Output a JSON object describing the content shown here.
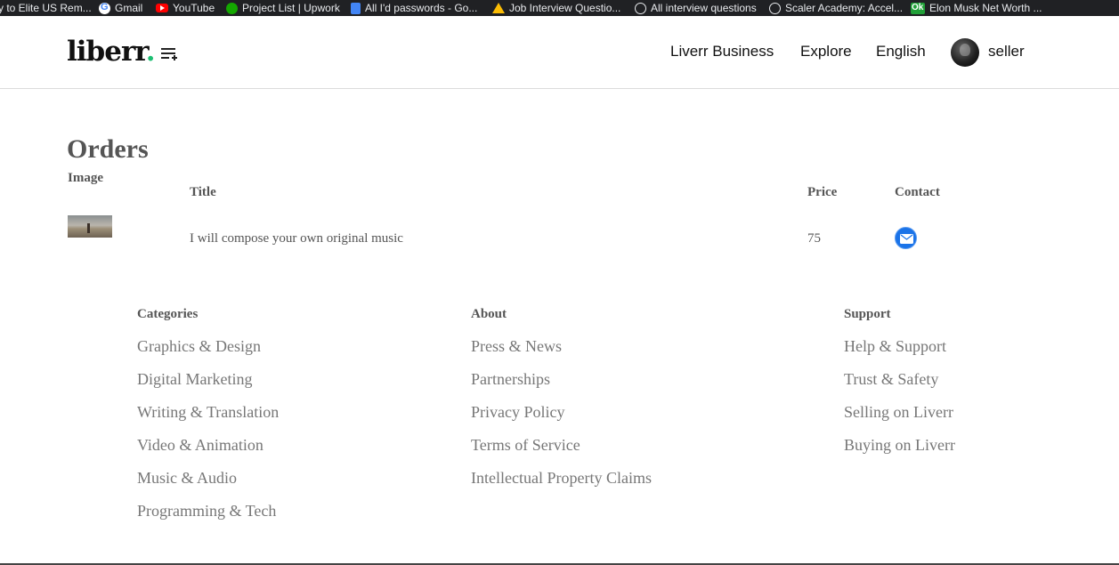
{
  "bookmarks": [
    "y to Elite US Rem...",
    "Gmail",
    "YouTube",
    "Project List | Upwork",
    "All I'd passwords - Go...",
    "Job Interview Questio...",
    "All interview questions",
    "Scaler Academy: Accel...",
    "Elon Musk Net Worth ..."
  ],
  "navbar": {
    "logo_text": "liberr",
    "logo_dot": ".",
    "business": "Liverr Business",
    "explore": "Explore",
    "language": "English",
    "username": "seller"
  },
  "orders": {
    "title": "Orders",
    "headers": {
      "image": "Image",
      "title": "Title",
      "price": "Price",
      "contact": "Contact"
    },
    "rows": [
      {
        "title": "I will compose your own original music",
        "price": "75"
      }
    ]
  },
  "footer": {
    "categories": {
      "heading": "Categories",
      "links": [
        "Graphics & Design",
        "Digital Marketing",
        "Writing & Translation",
        "Video & Animation",
        "Music & Audio",
        "Programming & Tech"
      ]
    },
    "about": {
      "heading": "About",
      "links": [
        "Press & News",
        "Partnerships",
        "Privacy Policy",
        "Terms of Service",
        "Intellectual Property Claims"
      ]
    },
    "support": {
      "heading": "Support",
      "links": [
        "Help & Support",
        "Trust & Safety",
        "Selling on Liverr",
        "Buying on Liverr"
      ]
    }
  },
  "colors": {
    "accent_dot": "#1dbf73",
    "mail_button": "#1a73e8"
  },
  "icons": {
    "menu": "menu-plus-icon",
    "contact": "mail-icon"
  }
}
